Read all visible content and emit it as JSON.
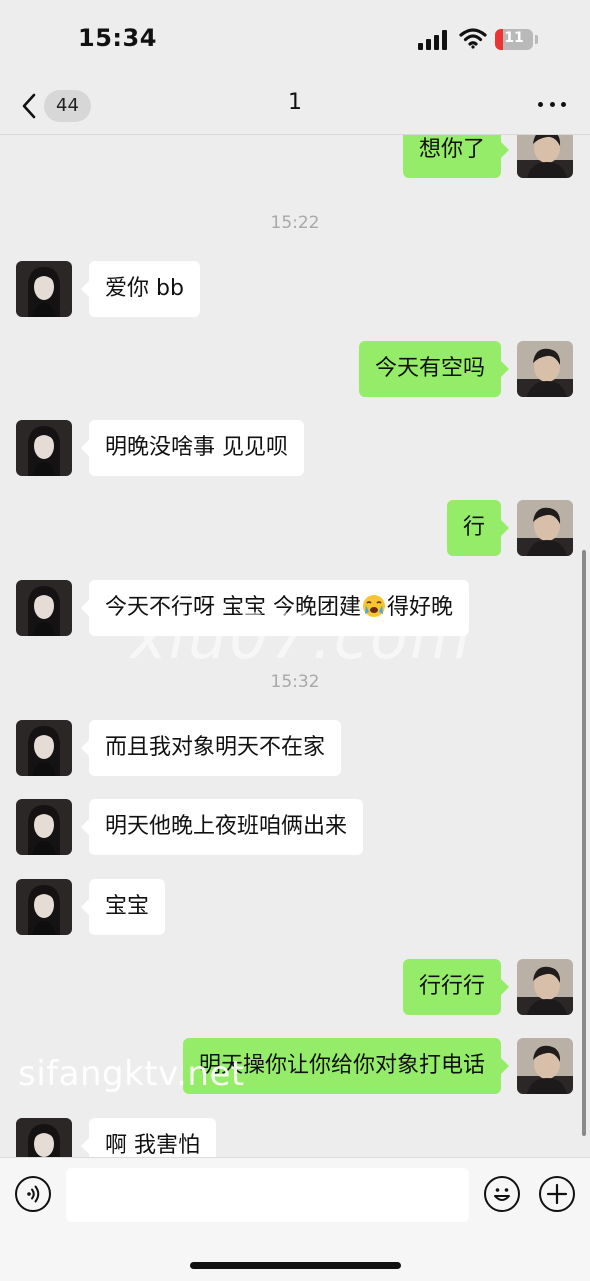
{
  "status_bar": {
    "time": "15:34",
    "battery": "11"
  },
  "nav": {
    "unread_count": "44",
    "title": "1"
  },
  "messages": [
    {
      "side": "out",
      "text": "想你了"
    },
    {
      "timestamp": "15:22"
    },
    {
      "side": "in",
      "text": "爱你 bb"
    },
    {
      "side": "out",
      "text": "今天有空吗"
    },
    {
      "side": "in",
      "text": "明晚没啥事 见见呗"
    },
    {
      "side": "out",
      "text": "行"
    },
    {
      "side": "in",
      "text_before": "今天不行呀 宝宝 今晚团建",
      "emoji": "loudly-crying-emoji",
      "text_after": "得好晚"
    },
    {
      "timestamp": "15:32"
    },
    {
      "side": "in",
      "text": "而且我对象明天不在家"
    },
    {
      "side": "in",
      "text": "明天他晚上夜班咱俩出来"
    },
    {
      "side": "in",
      "text": "宝宝"
    },
    {
      "side": "out",
      "text": "行行行"
    },
    {
      "side": "out",
      "text": "明天操你让你给你对象打电话"
    },
    {
      "side": "in",
      "text": "啊 我害怕"
    }
  ],
  "watermarks": {
    "center": "xiu07.com",
    "bottom": "sifangktv.net"
  },
  "input": {
    "placeholder": ""
  },
  "icons": {
    "back": "chevron-left-icon",
    "more": "more-dots-icon",
    "voice": "voice-icon",
    "emoji": "emoji-face-icon",
    "plus": "plus-icon"
  },
  "colors": {
    "outgoing_bubble": "#95ec69",
    "incoming_bubble": "#ffffff",
    "background": "#ededed"
  }
}
